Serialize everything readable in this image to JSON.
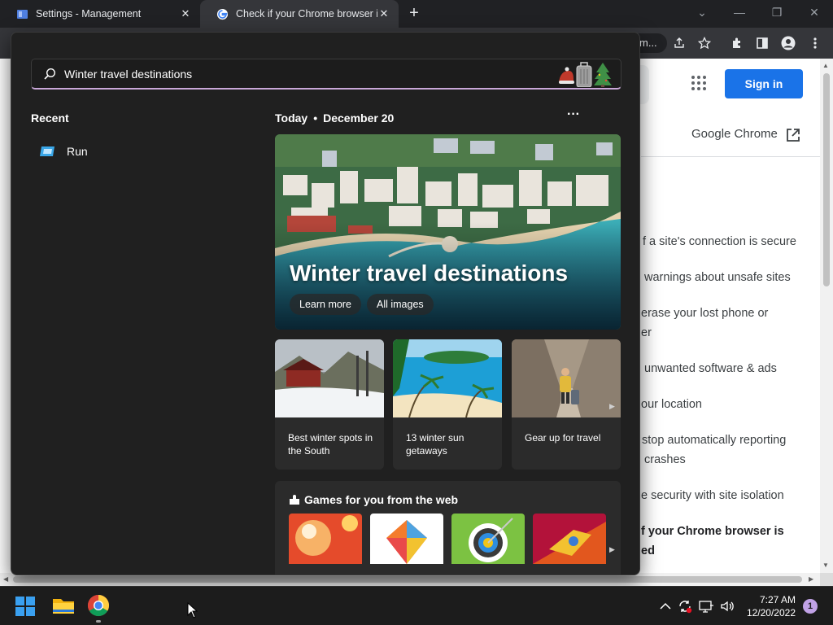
{
  "browser": {
    "tabs": [
      {
        "title": "Settings - Management",
        "active": false
      },
      {
        "title": "Check if your Chrome browser is",
        "active": true
      }
    ],
    "new_tab_label": "+",
    "omnibox_fragment": "m..."
  },
  "webpage": {
    "signin_label": "Sign in",
    "product_label": "Google Chrome",
    "items": [
      "f a site's connection is secure",
      "warnings about unsafe sites",
      "erase your lost phone or",
      "er",
      "unwanted software & ads",
      "our location",
      "stop automatically reporting",
      "crashes",
      "e security with site isolation",
      "f your Chrome browser is",
      "ed"
    ]
  },
  "search_panel": {
    "query": "Winter travel destinations",
    "recent_title": "Recent",
    "recent_items": [
      {
        "label": "Run",
        "icon": "run-icon"
      }
    ],
    "today_label": "Today",
    "date_label": "December 20",
    "hero": {
      "title": "Winter travel destinations",
      "learn_more": "Learn more",
      "all_images": "All images"
    },
    "cards": [
      {
        "label": "Best winter spots in the South"
      },
      {
        "label": "13 winter sun getaways"
      },
      {
        "label": "Gear up for travel"
      }
    ],
    "games_title": "Games for you from the web"
  },
  "taskbar": {
    "time": "7:27 AM",
    "date": "12/20/2022",
    "notification_count": "1"
  },
  "colors": {
    "accent": "#1a73e8",
    "flyout_bg": "#202020",
    "search_underline": "#c9a7d8"
  }
}
